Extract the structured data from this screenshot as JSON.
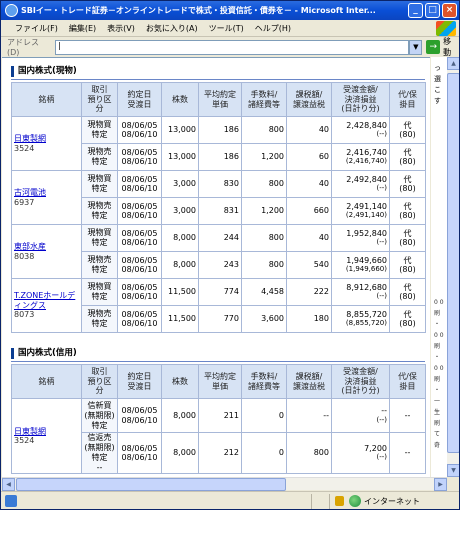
{
  "window": {
    "title": "SBIイー・トレード証券－オンライントレードで株式・投資信託・債券を－ - Microsoft Inter...",
    "minimize": "_",
    "maximize": "□",
    "close": "×"
  },
  "menu": [
    "ファイル(F)",
    "編集(E)",
    "表示(V)",
    "お気に入り(A)",
    "ツール(T)",
    "ヘルプ(H)"
  ],
  "address": {
    "label": "アドレス(D)",
    "value": "|",
    "go_label": "移動",
    "go_arrow": "→",
    "drop": "▼"
  },
  "right_pane_text": "っ 選 こ す",
  "right_pane_lower": "0 0 刷 ・ 0 0 刷 ・ 0 0 刷 ・ 一 生 刷 て 奇",
  "status": {
    "zone": "インターネット"
  },
  "cash": {
    "title": "国内株式(現物)",
    "headers": [
      "銘柄",
      "取引\n預り区分",
      "約定日\n受渡日",
      "株数",
      "平均約定\n単価",
      "手数料/\n諸経費等",
      "課税額/\n譲渡益税",
      "受渡金額/\n決済損益\n(日計り分)",
      "代/保\n掛目"
    ],
    "stocks": [
      {
        "name": "日東製網",
        "code": "3524",
        "rows": [
          {
            "type": "現物買",
            "acct": "特定",
            "trade": "08/06/05",
            "settle": "08/06/10",
            "shares": "13,000",
            "price": "186",
            "fee": "800",
            "tax": "40",
            "amount": "2,428,840",
            "pl": "(--)",
            "cat": "代",
            "ratio": "(80)"
          },
          {
            "type": "現物売",
            "acct": "特定",
            "trade": "08/06/05",
            "settle": "08/06/10",
            "shares": "13,000",
            "price": "186",
            "fee": "1,200",
            "tax": "60",
            "amount": "2,416,740",
            "pl": "(2,416,740)",
            "cat": "代",
            "ratio": "(80)"
          }
        ]
      },
      {
        "name": "古河電池",
        "code": "6937",
        "rows": [
          {
            "type": "現物買",
            "acct": "特定",
            "trade": "08/06/05",
            "settle": "08/06/10",
            "shares": "3,000",
            "price": "830",
            "fee": "800",
            "tax": "40",
            "amount": "2,492,840",
            "pl": "(--)",
            "cat": "代",
            "ratio": "(80)"
          },
          {
            "type": "現物売",
            "acct": "特定",
            "trade": "08/06/05",
            "settle": "08/06/10",
            "shares": "3,000",
            "price": "831",
            "fee": "1,200",
            "tax": "660",
            "amount": "2,491,140",
            "pl": "(2,491,140)",
            "cat": "代",
            "ratio": "(80)"
          }
        ]
      },
      {
        "name": "東部水産",
        "code": "8038",
        "rows": [
          {
            "type": "現物買",
            "acct": "特定",
            "trade": "08/06/05",
            "settle": "08/06/10",
            "shares": "8,000",
            "price": "244",
            "fee": "800",
            "tax": "40",
            "amount": "1,952,840",
            "pl": "(--)",
            "cat": "代",
            "ratio": "(80)"
          },
          {
            "type": "現物売",
            "acct": "特定",
            "trade": "08/06/05",
            "settle": "08/06/10",
            "shares": "8,000",
            "price": "243",
            "fee": "800",
            "tax": "540",
            "amount": "1,949,660",
            "pl": "(1,949,660)",
            "cat": "代",
            "ratio": "(80)"
          }
        ]
      },
      {
        "name": "T.ZONEホールディングス",
        "code": "8073",
        "rows": [
          {
            "type": "現物買",
            "acct": "特定",
            "trade": "08/06/05",
            "settle": "08/06/10",
            "shares": "11,500",
            "price": "774",
            "fee": "4,458",
            "tax": "222",
            "amount": "8,912,680",
            "pl": "(--)",
            "cat": "代",
            "ratio": "(80)"
          },
          {
            "type": "現物売",
            "acct": "特定",
            "trade": "08/06/05",
            "settle": "08/06/10",
            "shares": "11,500",
            "price": "770",
            "fee": "3,600",
            "tax": "180",
            "amount": "8,855,720",
            "pl": "(8,855,720)",
            "cat": "代",
            "ratio": "(80)"
          }
        ]
      }
    ]
  },
  "margin": {
    "title": "国内株式(信用)",
    "headers": [
      "銘柄",
      "取引\n預り区\n分",
      "約定日\n受渡日",
      "株数",
      "平均約定\n単価",
      "手数料/\n諸経費等",
      "課税額/\n譲渡益税",
      "受渡金額/\n決済損益\n(日計り分)",
      "代/保\n掛目"
    ],
    "stocks": [
      {
        "name": "日東製網",
        "code": "3524",
        "rows": [
          {
            "type": "信新買",
            "type2": "(無期限)",
            "acct": "特定",
            "trade": "08/06/05",
            "settle": "08/06/10",
            "shares": "8,000",
            "price": "211",
            "fee": "0",
            "tax": "--",
            "amount": "--",
            "pl": "(--)",
            "cat": "--",
            "ratio": ""
          },
          {
            "type": "信返売",
            "type2": "(無期限)",
            "acct": "特定",
            "trade": "08/06/05",
            "settle": "08/06/10",
            "shares": "8,000",
            "price": "212",
            "fee": "0",
            "tax": "800",
            "amount": "7,200",
            "pl": "(--)",
            "cat": "--",
            "ratio": "",
            "extra": "--"
          }
        ]
      }
    ]
  }
}
